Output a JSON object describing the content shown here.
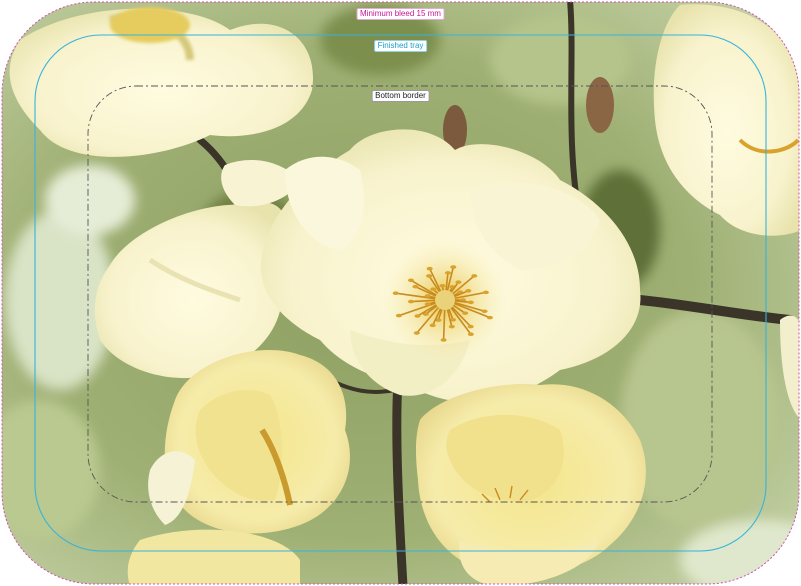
{
  "labels": {
    "minimum_bleed": "Minimum bleed 15 mm",
    "finished_tray": "Finished tray",
    "bottom_border": "Bottom border"
  },
  "photo": {
    "subject": "pale yellow wild roses with yellow stamens on a blurred green background",
    "colors": {
      "petal_light": "#fbf8d9",
      "petal_yellow": "#f3e9a0",
      "stamen": "#d9a22b",
      "foliage_light": "#c7d4a4",
      "foliage_dark": "#5d6e3b",
      "stem": "#3a342c"
    }
  },
  "guides": {
    "bleed_color": "#d24fb3",
    "finished_color": "#36b3dc",
    "bottom_color": "#555555"
  }
}
